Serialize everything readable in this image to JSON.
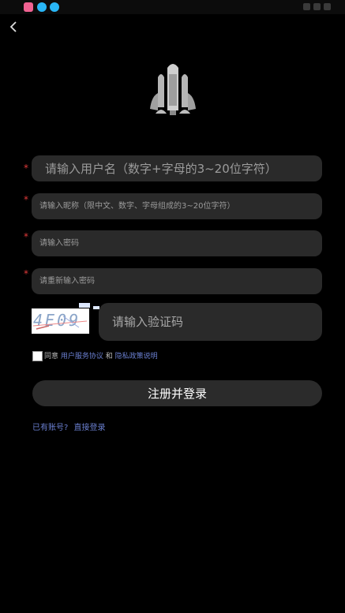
{
  "status_bar": {
    "icons": [
      "app-icon-pink",
      "app-icon-blue",
      "app-icon-blue"
    ]
  },
  "form": {
    "username_placeholder": "请输入用户名（数字+字母的3~20位字符）",
    "nickname_placeholder": "请输入昵称（限中文、数字、字母组成的3~20位字符）",
    "password_placeholder": "请输入密码",
    "confirm_password_placeholder": "请重新输入密码",
    "captcha_code": "4E09",
    "captcha_placeholder": "请输入验证码",
    "required_mark": "*"
  },
  "agreement": {
    "prefix": "同意",
    "link1": "用户服务协议",
    "and": "和",
    "link2": "隐私政策说明"
  },
  "submit_label": "注册并登录",
  "login": {
    "question": "已有账号?",
    "link": "直接登录"
  },
  "colors": {
    "accent_link": "#6a7fd0",
    "required": "#e03a3a",
    "field_bg": "#2a2a2a"
  }
}
